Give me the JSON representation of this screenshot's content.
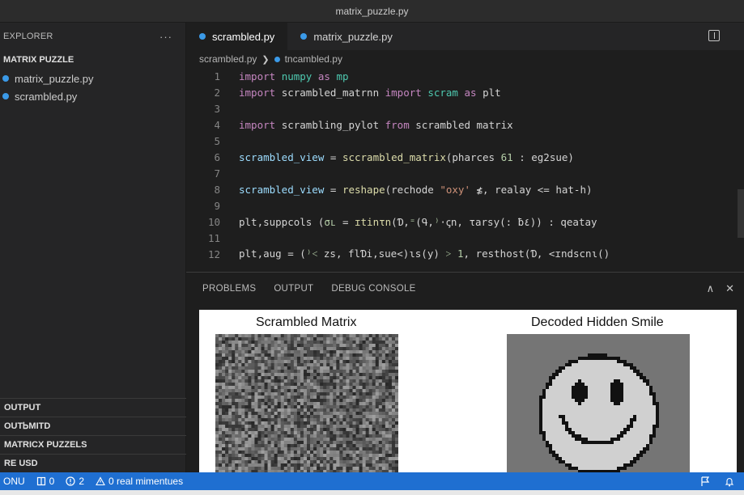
{
  "window": {
    "title": "matrix_puzzle.py"
  },
  "sidebar": {
    "header": "EXPLORER",
    "more": "···",
    "section": "MATRIX PUZZLE",
    "files": [
      {
        "label": "matrix_puzzle.py",
        "icon": "python-file-icon"
      },
      {
        "label": "scrambled.py",
        "icon": "python-file-icon"
      }
    ],
    "bottom_sections": [
      "OUTPUT",
      "OUTᏏMITD",
      "MATRICX PUZZELS",
      "RE USD"
    ]
  },
  "editor": {
    "tabs": [
      {
        "label": "scrambled.py",
        "active": true
      },
      {
        "label": "matrix_puzzle.py",
        "active": false
      }
    ],
    "breadcrumb": {
      "folder": "scrambled.py",
      "separator": "❯",
      "file": "tncambled.py"
    },
    "line_numbers": [
      "1",
      "2",
      "3",
      "4",
      "5",
      "6",
      "7",
      "8",
      "9",
      "10",
      "11",
      "12"
    ],
    "lines": [
      [
        [
          "kw",
          "import "
        ],
        [
          "fn",
          "numpy"
        ],
        [
          "kw",
          " as "
        ],
        [
          "fn",
          "mp"
        ]
      ],
      [
        [
          "kw",
          "import "
        ],
        [
          "plain",
          "scrambled_matrnn "
        ],
        [
          "kw",
          "import "
        ],
        [
          "fn",
          "scram"
        ],
        [
          "kw",
          " as "
        ],
        [
          "plain",
          "plt"
        ]
      ],
      [],
      [
        [
          "kw",
          "import "
        ],
        [
          "plain",
          "scrambling_pylot "
        ],
        [
          "kw",
          "from "
        ],
        [
          "plain",
          "scrambled matrix"
        ]
      ],
      [],
      [
        [
          "var",
          "scrambled_view"
        ],
        [
          "plain",
          " = "
        ],
        [
          "call",
          "sccrambled_matrix"
        ],
        [
          "plain",
          "(pharces "
        ],
        [
          "num",
          "61"
        ],
        [
          "plain",
          " : eg2sue)"
        ]
      ],
      [],
      [
        [
          "var",
          "scrambled_view"
        ],
        [
          "plain",
          " = "
        ],
        [
          "call",
          "reshape"
        ],
        [
          "plain",
          "(rechode "
        ],
        [
          "str",
          "\"oxy'"
        ],
        [
          "plain",
          " ≴, realay <= hat-h)"
        ]
      ],
      [],
      [
        [
          "plain",
          "plt,suppcols ("
        ],
        [
          "num",
          "σւ"
        ],
        [
          "plain",
          " = "
        ],
        [
          "call",
          "ɪtinτn"
        ],
        [
          "plain",
          "(Ɗ,"
        ],
        [
          "num",
          "⁼"
        ],
        [
          "plain",
          "(Գ,"
        ],
        [
          "num",
          "⁾"
        ],
        [
          "plain",
          "·ꞔn, τarsy(: ƀ٤)) : qeatay"
        ]
      ],
      [],
      [
        [
          "plain",
          "plt,aug = ("
        ],
        [
          "num",
          "⁾˂"
        ],
        [
          "plain",
          " zs, flƊi,sue<)ɩs(y)"
        ],
        [
          "num",
          " ˃ 1"
        ],
        [
          "plain",
          ", resthost(Ɗ, <ɪndscnɩ()"
        ]
      ]
    ]
  },
  "panel": {
    "tabs": [
      "PROBLEMS",
      "OUTPUT",
      "DEBUG CONSOLE"
    ],
    "actions": {
      "maximize": "∧",
      "close": "✕"
    },
    "figure": {
      "left_title": "Scrambled Matrix",
      "right_title": "Decoded Hidden Smile"
    }
  },
  "statusbar": {
    "branch": "ONU",
    "ports_icon": "ports-icon",
    "ports": "0",
    "errors_icon": "info-circle-icon",
    "errors": "2",
    "warning_icon": "warning-icon",
    "warning_text": "0 real mimentues",
    "right_icons": [
      "feedback-icon",
      "bell-icon"
    ]
  }
}
